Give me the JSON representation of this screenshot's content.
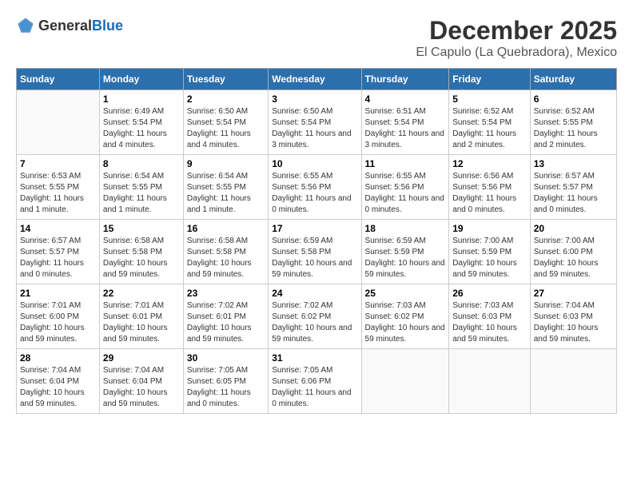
{
  "logo": {
    "general": "General",
    "blue": "Blue"
  },
  "title": "December 2025",
  "location": "El Capulo (La Quebradora), Mexico",
  "days_of_week": [
    "Sunday",
    "Monday",
    "Tuesday",
    "Wednesday",
    "Thursday",
    "Friday",
    "Saturday"
  ],
  "weeks": [
    [
      {
        "day": "",
        "sunrise": "",
        "sunset": "",
        "daylight": ""
      },
      {
        "day": "1",
        "sunrise": "Sunrise: 6:49 AM",
        "sunset": "Sunset: 5:54 PM",
        "daylight": "Daylight: 11 hours and 4 minutes."
      },
      {
        "day": "2",
        "sunrise": "Sunrise: 6:50 AM",
        "sunset": "Sunset: 5:54 PM",
        "daylight": "Daylight: 11 hours and 4 minutes."
      },
      {
        "day": "3",
        "sunrise": "Sunrise: 6:50 AM",
        "sunset": "Sunset: 5:54 PM",
        "daylight": "Daylight: 11 hours and 3 minutes."
      },
      {
        "day": "4",
        "sunrise": "Sunrise: 6:51 AM",
        "sunset": "Sunset: 5:54 PM",
        "daylight": "Daylight: 11 hours and 3 minutes."
      },
      {
        "day": "5",
        "sunrise": "Sunrise: 6:52 AM",
        "sunset": "Sunset: 5:54 PM",
        "daylight": "Daylight: 11 hours and 2 minutes."
      },
      {
        "day": "6",
        "sunrise": "Sunrise: 6:52 AM",
        "sunset": "Sunset: 5:55 PM",
        "daylight": "Daylight: 11 hours and 2 minutes."
      }
    ],
    [
      {
        "day": "7",
        "sunrise": "Sunrise: 6:53 AM",
        "sunset": "Sunset: 5:55 PM",
        "daylight": "Daylight: 11 hours and 1 minute."
      },
      {
        "day": "8",
        "sunrise": "Sunrise: 6:54 AM",
        "sunset": "Sunset: 5:55 PM",
        "daylight": "Daylight: 11 hours and 1 minute."
      },
      {
        "day": "9",
        "sunrise": "Sunrise: 6:54 AM",
        "sunset": "Sunset: 5:55 PM",
        "daylight": "Daylight: 11 hours and 1 minute."
      },
      {
        "day": "10",
        "sunrise": "Sunrise: 6:55 AM",
        "sunset": "Sunset: 5:56 PM",
        "daylight": "Daylight: 11 hours and 0 minutes."
      },
      {
        "day": "11",
        "sunrise": "Sunrise: 6:55 AM",
        "sunset": "Sunset: 5:56 PM",
        "daylight": "Daylight: 11 hours and 0 minutes."
      },
      {
        "day": "12",
        "sunrise": "Sunrise: 6:56 AM",
        "sunset": "Sunset: 5:56 PM",
        "daylight": "Daylight: 11 hours and 0 minutes."
      },
      {
        "day": "13",
        "sunrise": "Sunrise: 6:57 AM",
        "sunset": "Sunset: 5:57 PM",
        "daylight": "Daylight: 11 hours and 0 minutes."
      }
    ],
    [
      {
        "day": "14",
        "sunrise": "Sunrise: 6:57 AM",
        "sunset": "Sunset: 5:57 PM",
        "daylight": "Daylight: 11 hours and 0 minutes."
      },
      {
        "day": "15",
        "sunrise": "Sunrise: 6:58 AM",
        "sunset": "Sunset: 5:58 PM",
        "daylight": "Daylight: 10 hours and 59 minutes."
      },
      {
        "day": "16",
        "sunrise": "Sunrise: 6:58 AM",
        "sunset": "Sunset: 5:58 PM",
        "daylight": "Daylight: 10 hours and 59 minutes."
      },
      {
        "day": "17",
        "sunrise": "Sunrise: 6:59 AM",
        "sunset": "Sunset: 5:58 PM",
        "daylight": "Daylight: 10 hours and 59 minutes."
      },
      {
        "day": "18",
        "sunrise": "Sunrise: 6:59 AM",
        "sunset": "Sunset: 5:59 PM",
        "daylight": "Daylight: 10 hours and 59 minutes."
      },
      {
        "day": "19",
        "sunrise": "Sunrise: 7:00 AM",
        "sunset": "Sunset: 5:59 PM",
        "daylight": "Daylight: 10 hours and 59 minutes."
      },
      {
        "day": "20",
        "sunrise": "Sunrise: 7:00 AM",
        "sunset": "Sunset: 6:00 PM",
        "daylight": "Daylight: 10 hours and 59 minutes."
      }
    ],
    [
      {
        "day": "21",
        "sunrise": "Sunrise: 7:01 AM",
        "sunset": "Sunset: 6:00 PM",
        "daylight": "Daylight: 10 hours and 59 minutes."
      },
      {
        "day": "22",
        "sunrise": "Sunrise: 7:01 AM",
        "sunset": "Sunset: 6:01 PM",
        "daylight": "Daylight: 10 hours and 59 minutes."
      },
      {
        "day": "23",
        "sunrise": "Sunrise: 7:02 AM",
        "sunset": "Sunset: 6:01 PM",
        "daylight": "Daylight: 10 hours and 59 minutes."
      },
      {
        "day": "24",
        "sunrise": "Sunrise: 7:02 AM",
        "sunset": "Sunset: 6:02 PM",
        "daylight": "Daylight: 10 hours and 59 minutes."
      },
      {
        "day": "25",
        "sunrise": "Sunrise: 7:03 AM",
        "sunset": "Sunset: 6:02 PM",
        "daylight": "Daylight: 10 hours and 59 minutes."
      },
      {
        "day": "26",
        "sunrise": "Sunrise: 7:03 AM",
        "sunset": "Sunset: 6:03 PM",
        "daylight": "Daylight: 10 hours and 59 minutes."
      },
      {
        "day": "27",
        "sunrise": "Sunrise: 7:04 AM",
        "sunset": "Sunset: 6:03 PM",
        "daylight": "Daylight: 10 hours and 59 minutes."
      }
    ],
    [
      {
        "day": "28",
        "sunrise": "Sunrise: 7:04 AM",
        "sunset": "Sunset: 6:04 PM",
        "daylight": "Daylight: 10 hours and 59 minutes."
      },
      {
        "day": "29",
        "sunrise": "Sunrise: 7:04 AM",
        "sunset": "Sunset: 6:04 PM",
        "daylight": "Daylight: 10 hours and 59 minutes."
      },
      {
        "day": "30",
        "sunrise": "Sunrise: 7:05 AM",
        "sunset": "Sunset: 6:05 PM",
        "daylight": "Daylight: 11 hours and 0 minutes."
      },
      {
        "day": "31",
        "sunrise": "Sunrise: 7:05 AM",
        "sunset": "Sunset: 6:06 PM",
        "daylight": "Daylight: 11 hours and 0 minutes."
      },
      {
        "day": "",
        "sunrise": "",
        "sunset": "",
        "daylight": ""
      },
      {
        "day": "",
        "sunrise": "",
        "sunset": "",
        "daylight": ""
      },
      {
        "day": "",
        "sunrise": "",
        "sunset": "",
        "daylight": ""
      }
    ]
  ]
}
